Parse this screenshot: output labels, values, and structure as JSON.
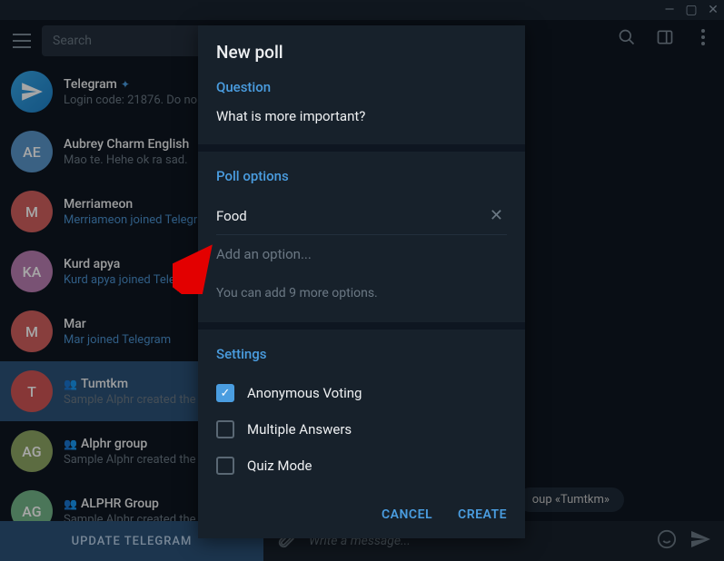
{
  "titlebar": {},
  "search": {
    "placeholder": "Search"
  },
  "chats": [
    {
      "avatar": "",
      "avatarBg": "linear-gradient(135deg,#37a7e8,#1f81c8)",
      "icon": "plane",
      "name": "Telegram",
      "verified": true,
      "preview": "Login code: 21876. Do no",
      "previewLink": false,
      "group": false
    },
    {
      "avatar": "AE",
      "avatarBg": "#5a95c9",
      "name": "Aubrey Charm English",
      "preview": "Mao te. Hehe ok ra sad.",
      "previewLink": false,
      "group": false
    },
    {
      "avatar": "M",
      "avatarBg": "#d2605e",
      "name": "Merriameon",
      "preview": "Merriameon joined Telegr",
      "previewLink": true,
      "group": false
    },
    {
      "avatar": "KA",
      "avatarBg": "#bb7eb2",
      "name": "Kurd apya",
      "preview": "Kurd apya joined Telegra",
      "previewLink": true,
      "group": false
    },
    {
      "avatar": "M",
      "avatarBg": "#d2605e",
      "name": "Mar",
      "preview": "Mar joined Telegram",
      "previewLink": true,
      "group": false
    },
    {
      "avatar": "T",
      "avatarBg": "#cf5555",
      "name": "Tumtkm",
      "preview": "Sample Alphr created the",
      "previewLink": false,
      "group": true,
      "active": true
    },
    {
      "avatar": "AG",
      "avatarBg": "#8ea764",
      "name": "Alphr group",
      "preview": "Sample Alphr created the",
      "previewLink": false,
      "group": true
    },
    {
      "avatar": "AG",
      "avatarBg": "#74b589",
      "name": "ALPHR Group",
      "preview": "Sample Alphr created the",
      "previewLink": false,
      "group": true
    }
  ],
  "updateBtn": "UPDATE TELEGRAM",
  "compose": {
    "placeholder": "Write a message..."
  },
  "groupPill": "oup «Tumtkm»",
  "dialog": {
    "title": "New poll",
    "questionLabel": "Question",
    "question": "What is more important?",
    "optionsLabel": "Poll options",
    "option1": "Food",
    "addOptionPlaceholder": "Add an option...",
    "hint": "You can add 9 more options.",
    "settingsLabel": "Settings",
    "anonLabel": "Anonymous Voting",
    "multiLabel": "Multiple Answers",
    "quizLabel": "Quiz Mode",
    "cancel": "CANCEL",
    "create": "CREATE"
  }
}
